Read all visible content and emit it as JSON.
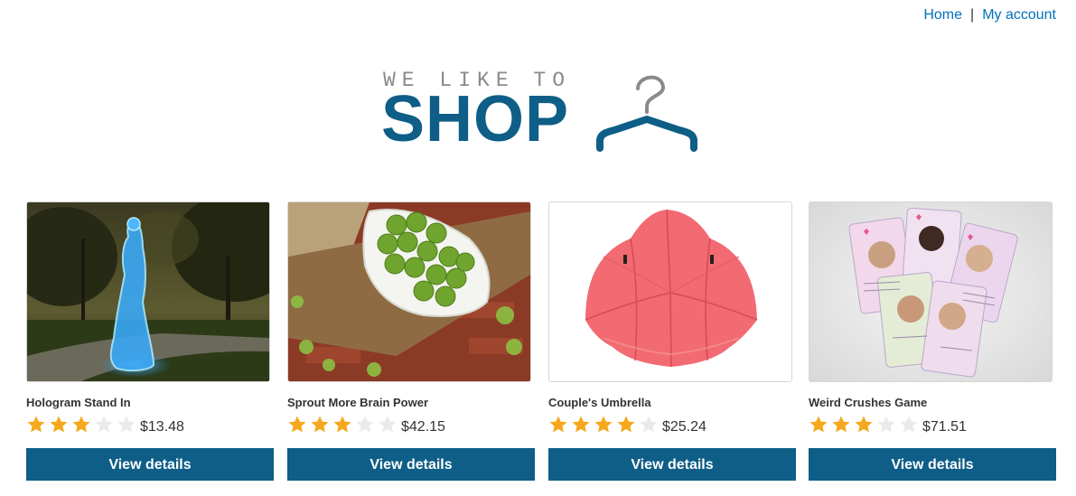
{
  "nav": {
    "home_label": "Home",
    "separator": "|",
    "account_label": "My account"
  },
  "logo": {
    "tagline": "WE LIKE TO",
    "wordmark": "SHOP",
    "icon": "hanger-icon"
  },
  "colors": {
    "brand": "#0e5e87",
    "link": "#0071bc",
    "star_filled": "#f6a81c",
    "star_empty": "#e8eaec"
  },
  "products": [
    {
      "name": "Hologram Stand In",
      "rating": 3,
      "rating_max": 5,
      "price": "$13.48",
      "button_label": "View details",
      "image": "hologram-woman-in-park-image"
    },
    {
      "name": "Sprout More Brain Power",
      "rating": 3,
      "rating_max": 5,
      "price": "$42.15",
      "button_label": "View details",
      "image": "brussels-sprouts-bowl-image"
    },
    {
      "name": "Couple's Umbrella",
      "rating": 4,
      "rating_max": 5,
      "price": "$25.24",
      "button_label": "View details",
      "image": "red-double-umbrella-image"
    },
    {
      "name": "Weird Crushes Game",
      "rating": 3,
      "rating_max": 5,
      "price": "$71.51",
      "button_label": "View details",
      "image": "celebrity-cards-game-image"
    }
  ]
}
